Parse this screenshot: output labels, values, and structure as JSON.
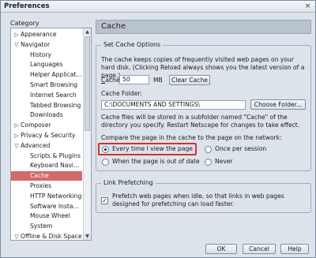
{
  "window": {
    "title": "Preferences",
    "close_glyph": "×"
  },
  "category": {
    "label": "Category",
    "items": [
      {
        "label": "Appearance",
        "twisty": "▷",
        "level": 0
      },
      {
        "label": "Navigator",
        "twisty": "▽",
        "level": 0
      },
      {
        "label": "History",
        "twisty": "",
        "level": 1
      },
      {
        "label": "Languages",
        "twisty": "",
        "level": 1
      },
      {
        "label": "Helper Applicat...",
        "twisty": "",
        "level": 1
      },
      {
        "label": "Smart Browsing",
        "twisty": "",
        "level": 1
      },
      {
        "label": "Internet Search",
        "twisty": "",
        "level": 1
      },
      {
        "label": "Tabbed Browsing",
        "twisty": "",
        "level": 1
      },
      {
        "label": "Downloads",
        "twisty": "",
        "level": 1
      },
      {
        "label": "Composer",
        "twisty": "▷",
        "level": 0
      },
      {
        "label": "Privacy & Security",
        "twisty": "▷",
        "level": 0
      },
      {
        "label": "Advanced",
        "twisty": "▽",
        "level": 0
      },
      {
        "label": "Scripts & Plugins",
        "twisty": "",
        "level": 1
      },
      {
        "label": "Keyboard Navi...",
        "twisty": "",
        "level": 1
      },
      {
        "label": "Cache",
        "twisty": "",
        "level": 1,
        "selected": true
      },
      {
        "label": "Proxies",
        "twisty": "",
        "level": 1
      },
      {
        "label": "HTTP Networking",
        "twisty": "",
        "level": 1
      },
      {
        "label": "Software Insta...",
        "twisty": "",
        "level": 1
      },
      {
        "label": "Mouse Wheel",
        "twisty": "",
        "level": 1
      },
      {
        "label": "System",
        "twisty": "",
        "level": 1
      },
      {
        "label": "Offline & Disk Space",
        "twisty": "▽",
        "level": 0
      }
    ]
  },
  "panel": {
    "title": "Cache"
  },
  "cache_options": {
    "group_title": "Set Cache Options",
    "description": "The cache keeps copies of frequently visited web pages on your hard disk. (Clicking Reload always shows you the latest version of a page.)",
    "cache_label": "Cache:",
    "cache_value": "50",
    "cache_unit": "MB",
    "clear_button": "Clear Cache",
    "folder_label": "Cache Folder:",
    "folder_value": "C:\\DOCUMENTS AND SETTINGS\\",
    "choose_button": "Choose Folder...",
    "folder_note": "Cache files will be stored in a subfolder named \"Cache\" of the directory you specify. Restart Netscape for changes to take effect.",
    "compare_label": "Compare the page in the cache to the page on the network:",
    "radio_every_time": "Every time I view the page",
    "radio_once": "Once per session",
    "radio_out_of_date": "When the page is out of date",
    "radio_never": "Never"
  },
  "link_prefetch": {
    "group_title": "Link Prefetching",
    "checkbox_text": "Prefetch web pages when idle, so that links in web pages designed for prefetching can load faster.",
    "checked_glyph": "✓"
  },
  "buttons": {
    "ok": "OK",
    "cancel": "Cancel",
    "help": "Help"
  },
  "colors": {
    "selection": "#d26a6a",
    "highlight": "#d23232",
    "panel_header": "#b9c3ce"
  }
}
